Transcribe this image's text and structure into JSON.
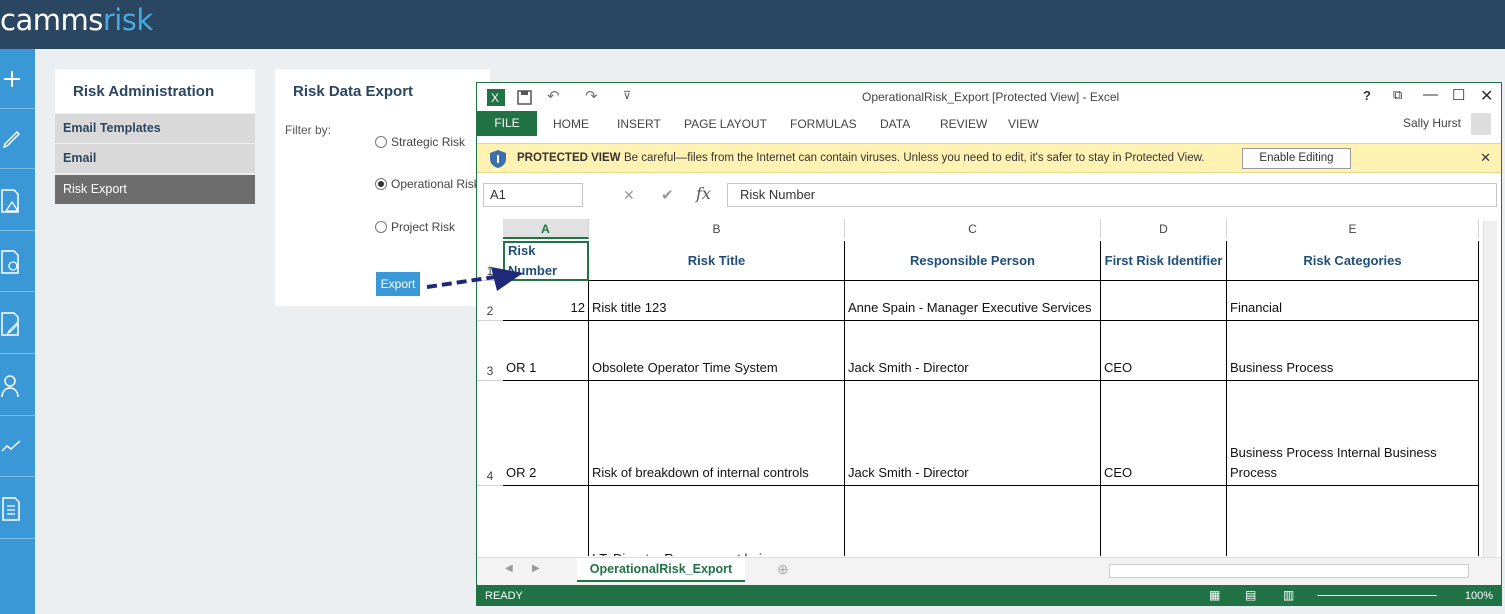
{
  "app": {
    "logo_main": "camms",
    "logo_accent": "risk"
  },
  "nav": {
    "icons": [
      "plus-icon",
      "pencil-icon",
      "report-warning-icon",
      "report-search-icon",
      "report-edit-icon",
      "user-settings-icon",
      "trend-icon",
      "document-icon"
    ]
  },
  "sidebar": {
    "title": "Risk Administration",
    "items": [
      {
        "label": "Email Templates"
      },
      {
        "label": "Email"
      },
      {
        "label": "Risk Export"
      }
    ]
  },
  "export": {
    "title": "Risk Data Export",
    "filter_label": "Filter by:",
    "options": [
      {
        "label": "Strategic Risk",
        "selected": false
      },
      {
        "label": "Operational Risk",
        "selected": true
      },
      {
        "label": "Project Risk",
        "selected": false
      }
    ],
    "button": "Export"
  },
  "excel": {
    "title": "OperationalRisk_Export  [Protected View] - Excel",
    "tabs": [
      "FILE",
      "HOME",
      "INSERT",
      "PAGE LAYOUT",
      "FORMULAS",
      "DATA",
      "REVIEW",
      "VIEW"
    ],
    "user": "Sally Hurst",
    "protected": {
      "label": "PROTECTED VIEW",
      "message": "Be careful—files from the Internet can contain viruses. Unless you need to edit, it's safer to stay in Protected View.",
      "button": "Enable Editing"
    },
    "namebox": "A1",
    "formula": "Risk Number",
    "columns": [
      "A",
      "B",
      "C",
      "D",
      "E"
    ],
    "rows": [
      {
        "num": "1",
        "cells": [
          "Risk Number",
          "Risk Title",
          "Responsible Person",
          "First Risk Identifier",
          "Risk Categories"
        ]
      },
      {
        "num": "2",
        "cells": [
          "12",
          "Risk title 123",
          "Anne Spain - Manager Executive Services",
          "",
          "Financial"
        ]
      },
      {
        "num": "3",
        "cells": [
          "OR 1",
          "Obsolete Operator Time System",
          "Jack Smith - Director",
          "CEO",
          "Business Process"
        ]
      },
      {
        "num": "4",
        "cells": [
          "OR 2",
          "Risk of breakdown of internal controls",
          "Jack Smith - Director",
          "CEO",
          "Business Process Internal Business Process"
        ]
      },
      {
        "num": "",
        "cells": [
          "",
          "I.T. Disaster Recovery not being",
          "",
          "",
          ""
        ]
      }
    ],
    "sheet_tab": "OperationalRisk_Export",
    "status": "READY",
    "zoom": "100%"
  }
}
